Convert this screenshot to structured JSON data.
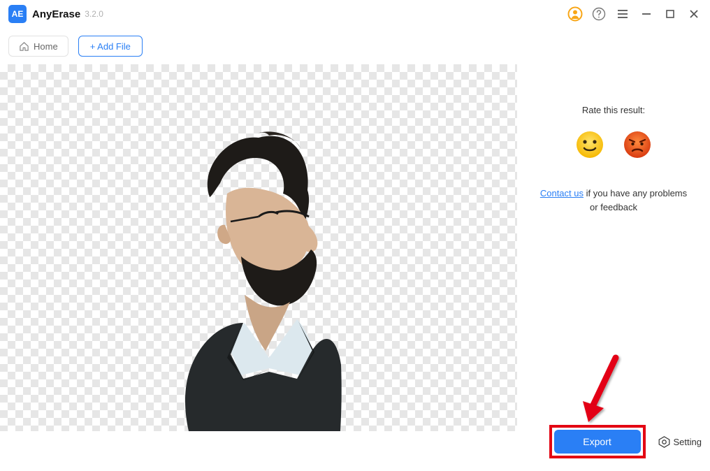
{
  "app": {
    "logo_text": "AE",
    "name": "AnyErase",
    "version": "3.2.0"
  },
  "toolbar": {
    "home_label": "Home",
    "add_file_label": "+ Add File"
  },
  "sidebar": {
    "rate_title": "Rate this result:",
    "contact_link": "Contact us",
    "feedback_rest": " if you have any problems or feedback"
  },
  "bottom": {
    "export_label": "Export",
    "setting_label": "Setting"
  },
  "colors": {
    "accent": "#2a7ff5",
    "highlight_red": "#e30613",
    "user_ring": "#f8a617"
  }
}
